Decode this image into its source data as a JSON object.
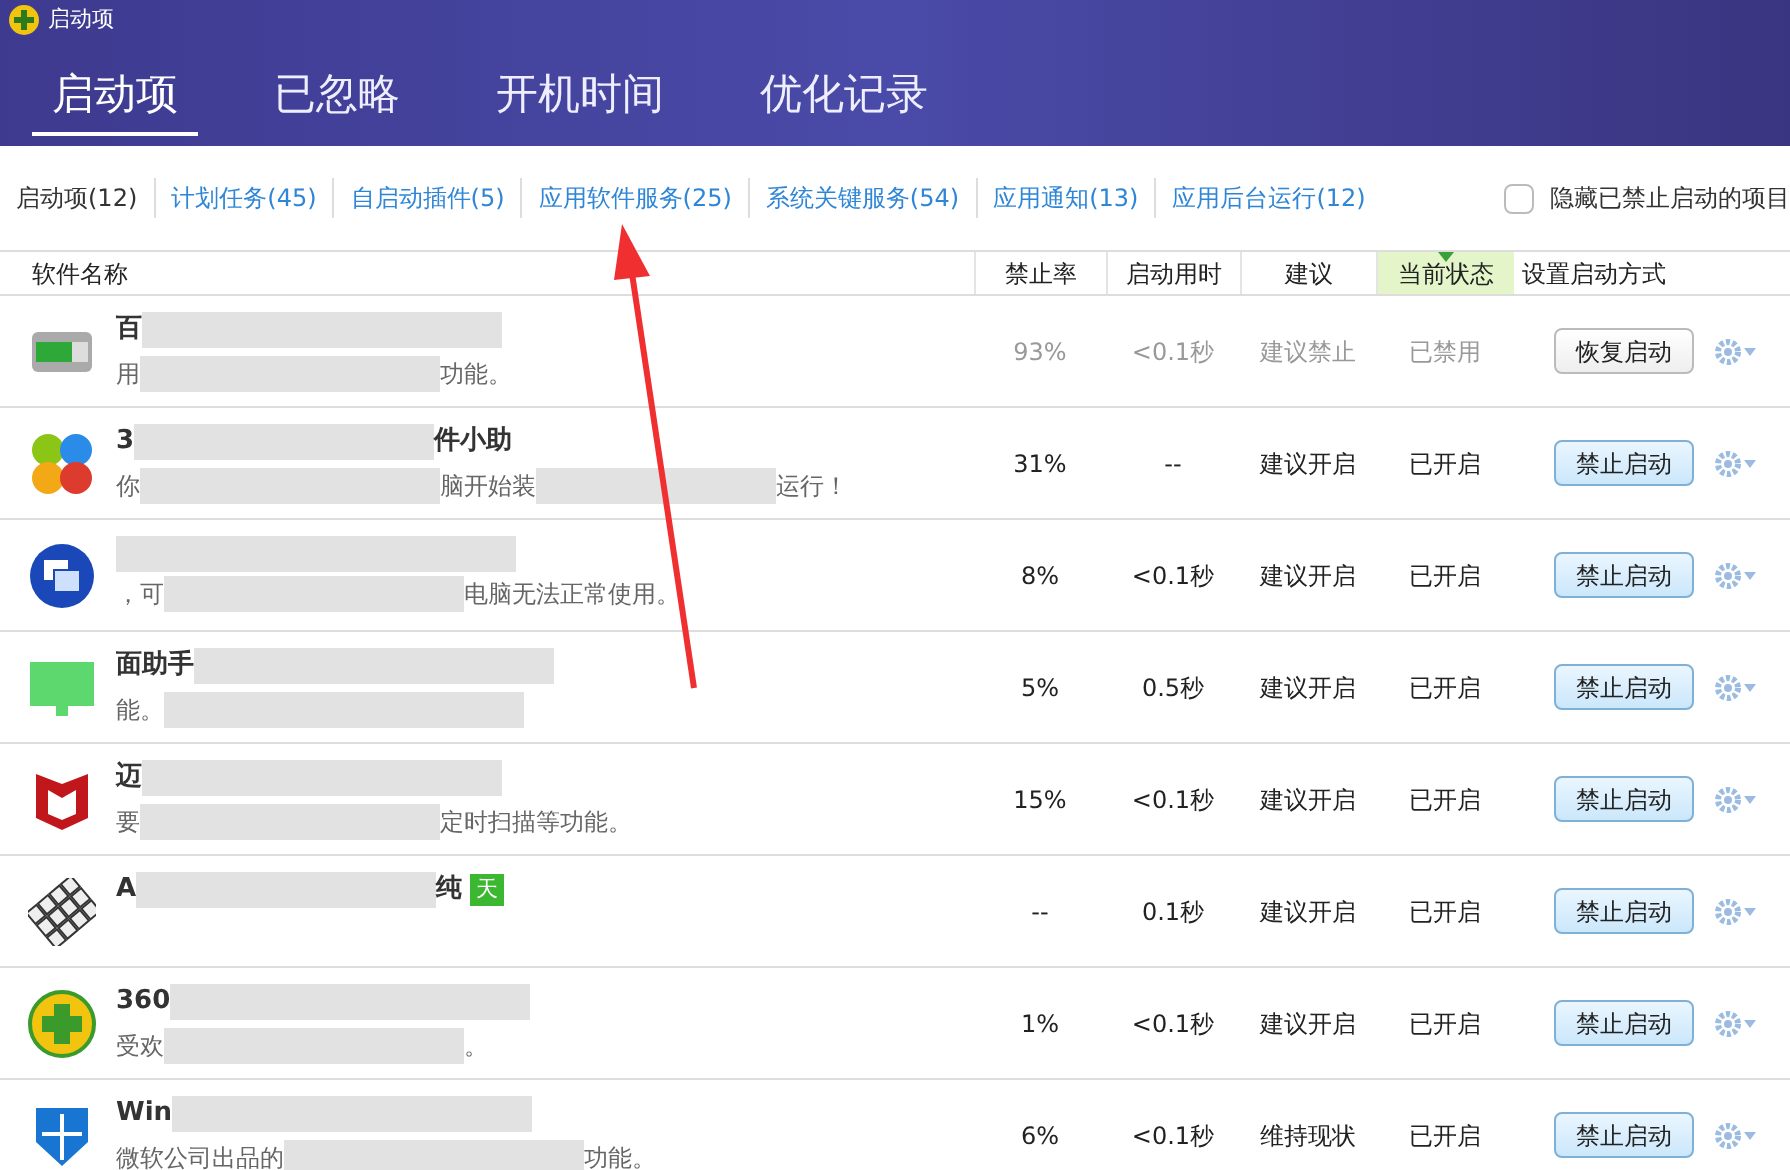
{
  "window": {
    "title": "启动项"
  },
  "tabs": [
    {
      "label": "启动项",
      "selected": true
    },
    {
      "label": "已忽略",
      "selected": false
    },
    {
      "label": "开机时间",
      "selected": false
    },
    {
      "label": "优化记录",
      "selected": false
    }
  ],
  "categories": [
    {
      "label": "启动项(12)",
      "selected": true
    },
    {
      "label": "计划任务(45)",
      "selected": false
    },
    {
      "label": "自启动插件(5)",
      "selected": false
    },
    {
      "label": "应用软件服务(25)",
      "selected": false
    },
    {
      "label": "系统关键服务(54)",
      "selected": false
    },
    {
      "label": "应用通知(13)",
      "selected": false
    },
    {
      "label": "应用后台运行(12)",
      "selected": false
    }
  ],
  "hide_disabled": {
    "label": "隐藏已禁止启动的项目",
    "checked": false
  },
  "table": {
    "columns": [
      {
        "label": "软件名称",
        "sorted": false
      },
      {
        "label": "禁止率",
        "sorted": false
      },
      {
        "label": "启动用时",
        "sorted": false
      },
      {
        "label": "建议",
        "sorted": false
      },
      {
        "label": "当前状态",
        "sorted": true
      },
      {
        "label": "设置启动方式",
        "sorted": false
      }
    ],
    "rows": [
      {
        "kind": "battery",
        "name": [
          "百"
        ],
        "desc": [
          "用",
          "功能。"
        ],
        "rate": "93%",
        "time": "<0.1秒",
        "advice": "建议禁止",
        "status": "已禁用",
        "enabled": false,
        "action": "恢复启动"
      },
      {
        "kind": "balls",
        "name": [
          "3",
          "件小助"
        ],
        "desc": [
          "你",
          "脑开始装",
          "运行！"
        ],
        "rate": "31%",
        "time": "--",
        "advice": "建议开启",
        "status": "已开启",
        "enabled": true,
        "action": "禁止启动"
      },
      {
        "kind": "windows",
        "name": [],
        "desc": [
          "，可",
          "电脑无法正常使用。"
        ],
        "rate": "8%",
        "time": "<0.1秒",
        "advice": "建议开启",
        "status": "已开启",
        "enabled": true,
        "action": "禁止启动"
      },
      {
        "kind": "monitor",
        "name": [
          "面助手"
        ],
        "desc": [
          "能。"
        ],
        "rate": "5%",
        "time": "0.5秒",
        "advice": "建议开启",
        "status": "已开启",
        "enabled": true,
        "action": "禁止启动"
      },
      {
        "kind": "mshield",
        "name": [
          "迈"
        ],
        "desc": [
          "要",
          "定时扫描等功能。"
        ],
        "rate": "15%",
        "time": "<0.1秒",
        "advice": "建议开启",
        "status": "已开启",
        "enabled": true,
        "action": "禁止启动"
      },
      {
        "kind": "keyboard",
        "name": [
          "A",
          "纯"
        ],
        "badge": "天",
        "desc": [],
        "rate": "--",
        "time": "0.1秒",
        "advice": "建议开启",
        "status": "已开启",
        "enabled": true,
        "action": "禁止启动"
      },
      {
        "kind": "plus",
        "name": [
          "360"
        ],
        "desc": [
          "受欢",
          "。"
        ],
        "rate": "1%",
        "time": "<0.1秒",
        "advice": "建议开启",
        "status": "已开启",
        "enabled": true,
        "action": "禁止启动"
      },
      {
        "kind": "shield",
        "name": [
          "Win"
        ],
        "desc": [
          "微软公司出品的",
          "功能。"
        ],
        "rate": "6%",
        "time": "<0.1秒",
        "advice": "维持现状",
        "status": "已开启",
        "enabled": true,
        "action": "禁止启动"
      }
    ]
  }
}
